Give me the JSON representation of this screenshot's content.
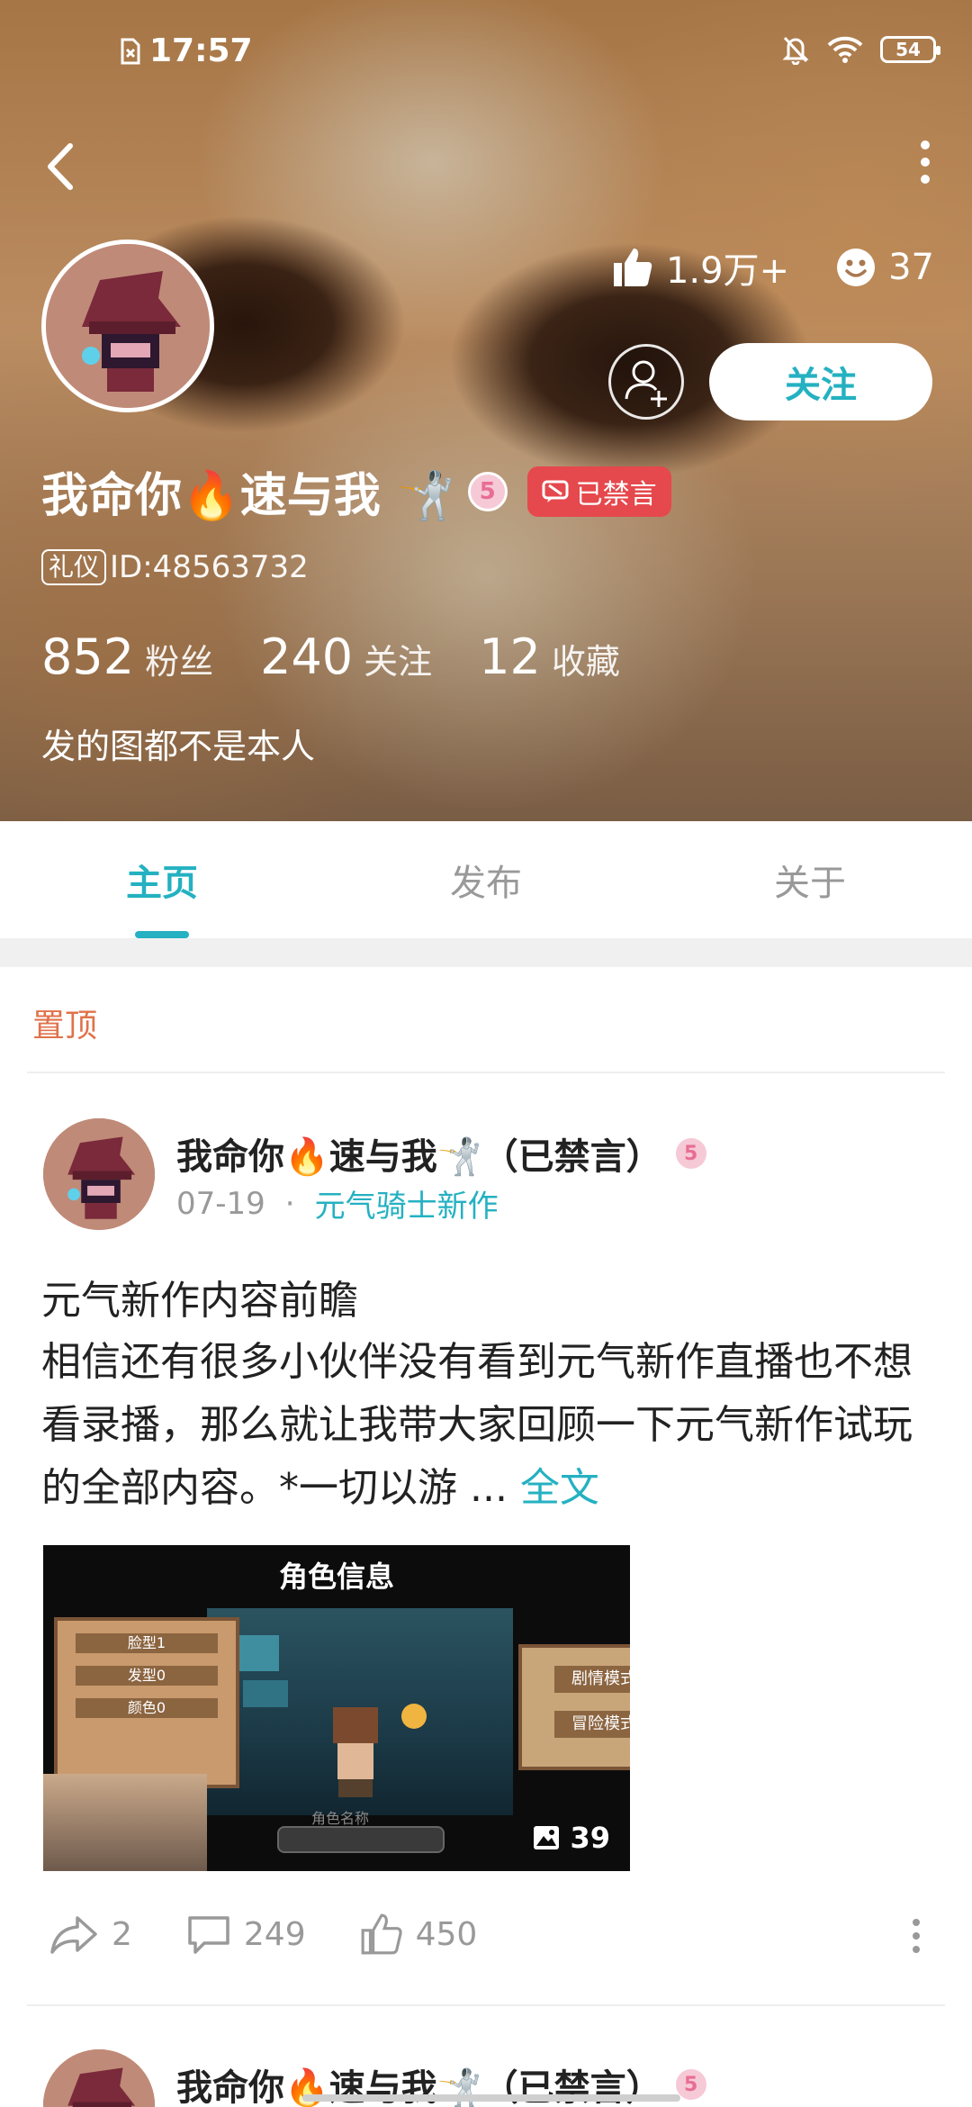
{
  "status_bar": {
    "time": "17:57",
    "battery": "54"
  },
  "header": {
    "likes": "1.9万+",
    "smiles": "37",
    "follow_label": "关注",
    "user_name": "我命你🔥速与我 🤺",
    "level": "5",
    "banned_label": "已禁言",
    "etiquette_tag": "礼仪",
    "user_id": "ID:48563732",
    "stats": [
      {
        "value": "852",
        "label": "粉丝"
      },
      {
        "value": "240",
        "label": "关注"
      },
      {
        "value": "12",
        "label": "收藏"
      }
    ],
    "bio": "发的图都不是本人"
  },
  "tabs": [
    {
      "label": "主页",
      "active": true
    },
    {
      "label": "发布",
      "active": false
    },
    {
      "label": "关于",
      "active": false
    }
  ],
  "pinned_label": "置顶",
  "post": {
    "author": "我命你🔥速与我🤺（已禁言）",
    "level": "5",
    "date": "07-19",
    "dot": "·",
    "topic": "元气骑士新作",
    "title": "元气新作内容前瞻",
    "body": "相信还有很多小伙伴没有看到元气新作直播也不想看录播，那么就让我带大家回顾一下元气新作试玩的全部内容。*一切以游 ... ",
    "full_text_link": "全文",
    "image": {
      "title": "角色信息",
      "left_rows": [
        "脸型1",
        "发型0",
        "颜色0"
      ],
      "right_options": [
        "剧情模式",
        "冒险模式"
      ],
      "name_hint": "角色名称",
      "count": "39"
    },
    "shares": "2",
    "comments": "249",
    "likes": "450"
  },
  "next_post": {
    "author": "我命你🔥速与我🤺（已禁言）",
    "level": "5"
  },
  "colors": {
    "accent": "#24b1c1",
    "pinned": "#e0724a",
    "banned": "#e5484d"
  }
}
